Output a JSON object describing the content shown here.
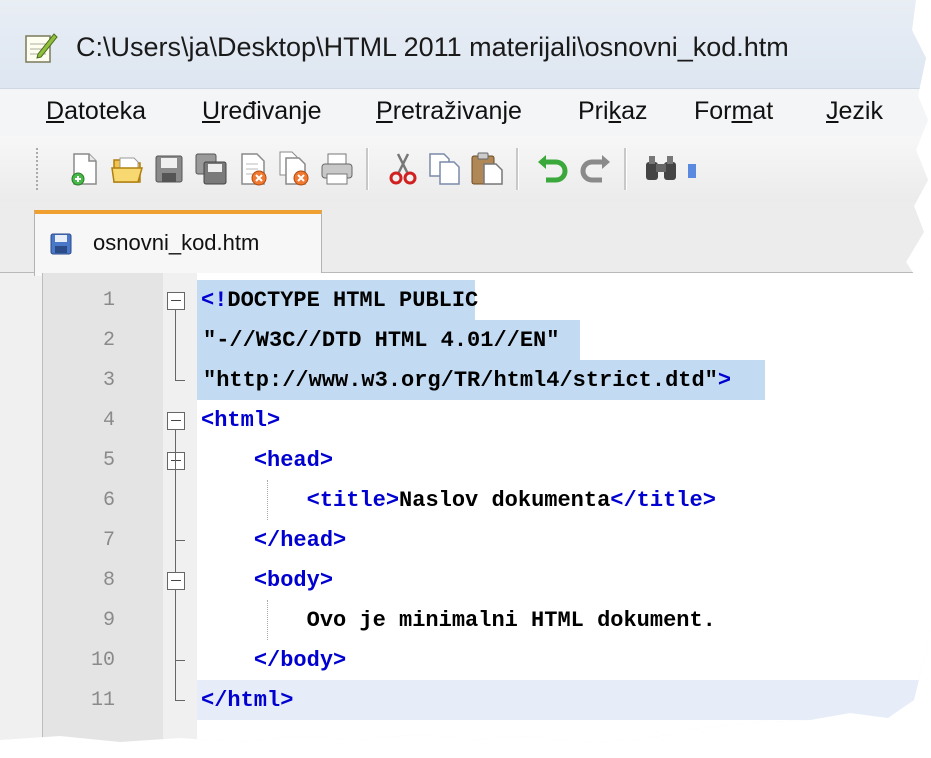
{
  "window": {
    "title": "C:\\Users\\ja\\Desktop\\HTML 2011 materijali\\osnovni_kod.htm"
  },
  "menu": [
    {
      "pre": "",
      "ul": "D",
      "post": "atoteka"
    },
    {
      "pre": "",
      "ul": "U",
      "post": "ređivanje"
    },
    {
      "pre": "",
      "ul": "P",
      "post": "retraživanje"
    },
    {
      "pre": "Pri",
      "ul": "k",
      "post": "az"
    },
    {
      "pre": "For",
      "ul": "m",
      "post": "at"
    },
    {
      "pre": "",
      "ul": "J",
      "post": "ezik"
    }
  ],
  "toolbar": {
    "icons": [
      "new-file-icon",
      "open-file-icon",
      "save-icon",
      "save-all-icon",
      "close-icon",
      "close-all-icon",
      "print-icon",
      "cut-icon",
      "copy-icon",
      "paste-icon",
      "undo-icon",
      "redo-icon",
      "find-icon"
    ]
  },
  "tab": {
    "label": "osnovni_kod.htm"
  },
  "editor": {
    "line_numbers": [
      "1",
      "2",
      "3",
      "4",
      "5",
      "6",
      "7",
      "8",
      "9",
      "10",
      "11"
    ],
    "lines": [
      {
        "segments": [
          {
            "cls": "tag",
            "t": "<!"
          },
          {
            "cls": "plain",
            "t": "DOCTYPE HTML PUBLIC"
          }
        ]
      },
      {
        "segments": [
          {
            "cls": "str",
            "t": "\"-//W3C//DTD HTML 4.01//EN\""
          }
        ]
      },
      {
        "segments": [
          {
            "cls": "str",
            "t": "\"http://www.w3.org/TR/html4/strict.dtd\""
          },
          {
            "cls": "tag",
            "t": ">"
          }
        ]
      },
      {
        "segments": [
          {
            "cls": "tag",
            "t": "<html>"
          }
        ]
      },
      {
        "segments": [
          {
            "cls": "plain",
            "t": "    "
          },
          {
            "cls": "tag",
            "t": "<head>"
          }
        ]
      },
      {
        "segments": [
          {
            "cls": "plain",
            "t": "        "
          },
          {
            "cls": "tag",
            "t": "<title>"
          },
          {
            "cls": "plain",
            "t": "Naslov dokumenta"
          },
          {
            "cls": "tag",
            "t": "</title>"
          }
        ]
      },
      {
        "segments": [
          {
            "cls": "plain",
            "t": "    "
          },
          {
            "cls": "tag",
            "t": "</head>"
          }
        ]
      },
      {
        "segments": [
          {
            "cls": "plain",
            "t": "    "
          },
          {
            "cls": "tag",
            "t": "<body>"
          }
        ]
      },
      {
        "segments": [
          {
            "cls": "plain",
            "t": "        Ovo je minimalni HTML dokument."
          }
        ]
      },
      {
        "segments": [
          {
            "cls": "plain",
            "t": "    "
          },
          {
            "cls": "tag",
            "t": "</body>"
          }
        ]
      },
      {
        "segments": [
          {
            "cls": "tag",
            "t": "</html>"
          }
        ]
      }
    ]
  }
}
